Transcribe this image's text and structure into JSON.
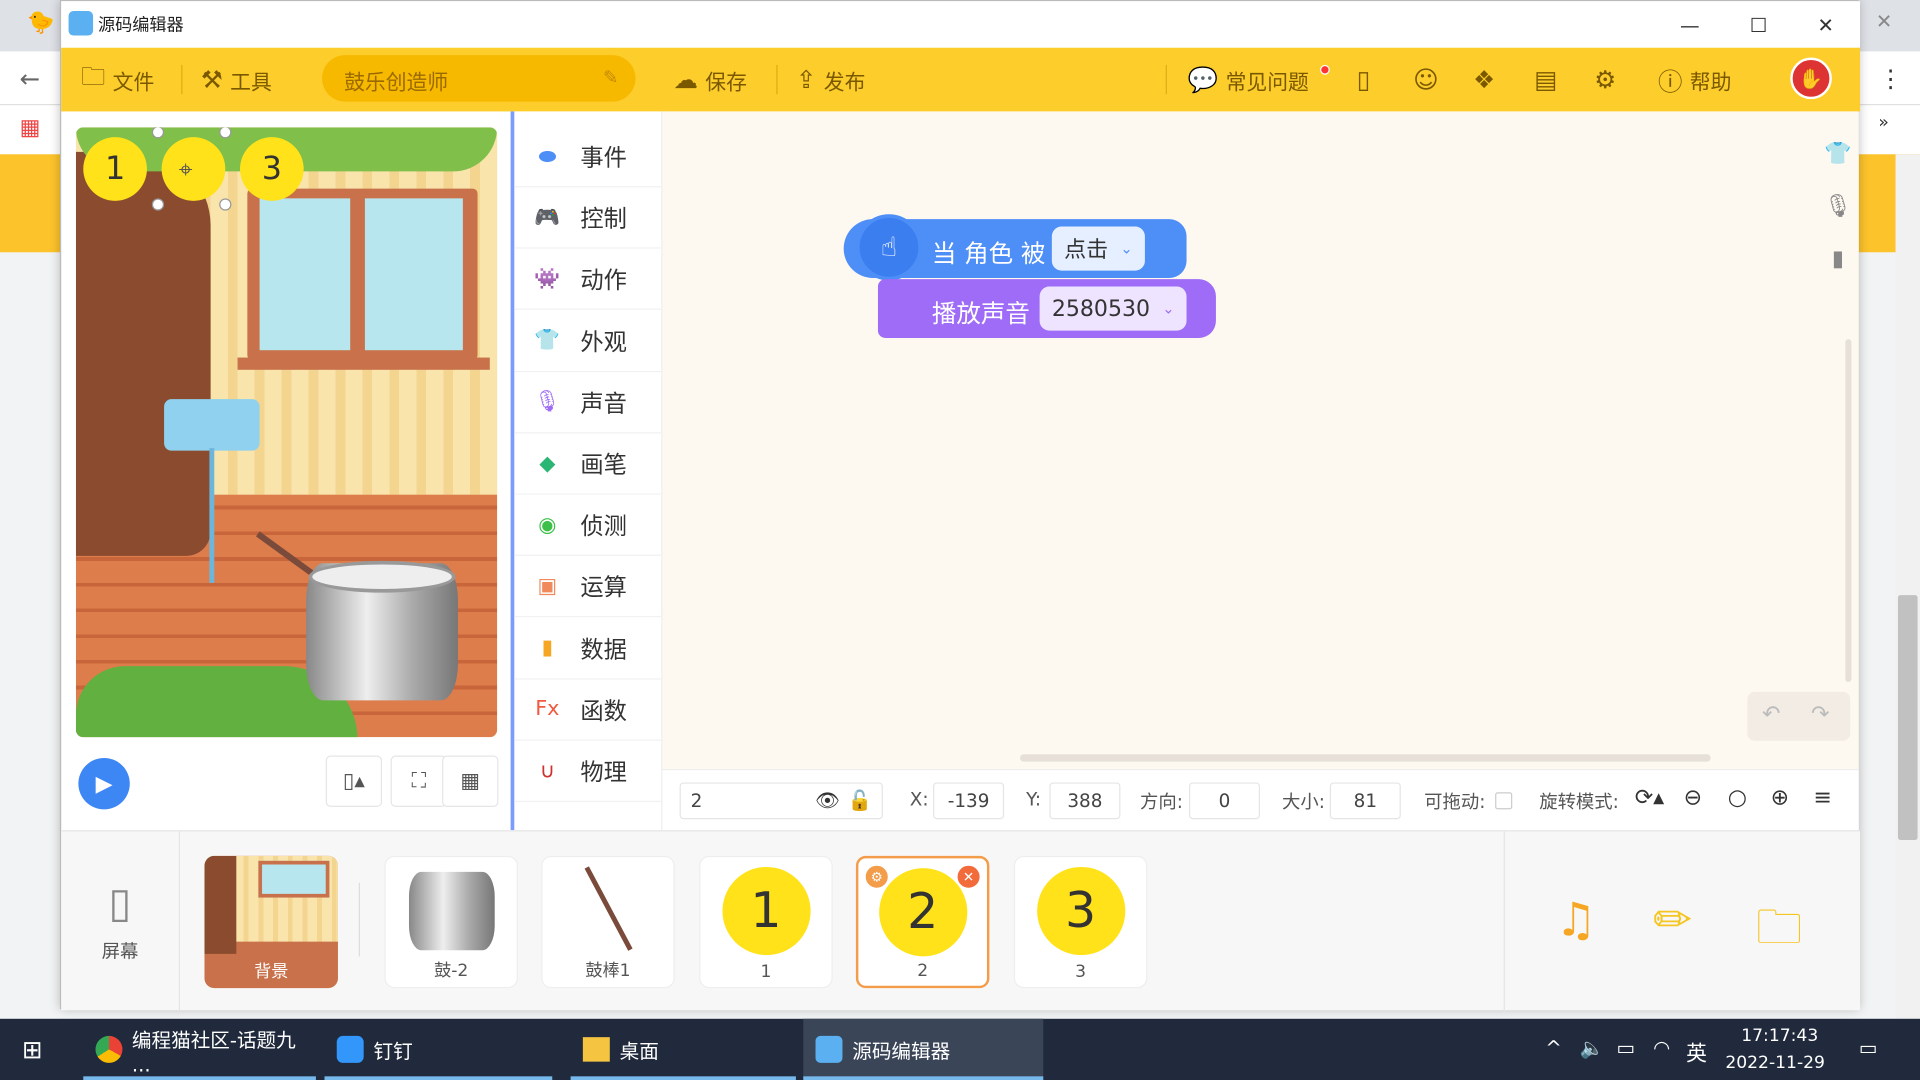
{
  "window": {
    "title": "源码编辑器",
    "minimize": "—",
    "maximize": "☐",
    "close": "✕"
  },
  "toolbar": {
    "file": "文件",
    "tools": "工具",
    "project_name": "鼓乐创造师",
    "save": "保存",
    "publish": "发布",
    "faq": "常见问题",
    "help": "帮助"
  },
  "stage": {
    "bubbles": [
      "1",
      "3"
    ]
  },
  "categories": [
    {
      "label": "事件",
      "color": "#4d8ef7",
      "icon": "toggle-icon"
    },
    {
      "label": "控制",
      "color": "#2fa6d8",
      "icon": "gamepad-icon"
    },
    {
      "label": "动作",
      "color": "#e8475a",
      "icon": "ghost-icon"
    },
    {
      "label": "外观",
      "color": "#e056c9",
      "icon": "shirt-icon"
    },
    {
      "label": "声音",
      "color": "#9f6cf7",
      "icon": "mic-icon"
    },
    {
      "label": "画笔",
      "color": "#2bb673",
      "icon": "pen-icon"
    },
    {
      "label": "侦测",
      "color": "#3cc04a",
      "icon": "radar-icon"
    },
    {
      "label": "运算",
      "color": "#f08a5d",
      "icon": "calc-icon"
    },
    {
      "label": "数据",
      "color": "#f5a623",
      "icon": "bars-icon"
    },
    {
      "label": "函数",
      "color": "#f05a3e",
      "icon": "fx-icon"
    },
    {
      "label": "物理",
      "color": "#d0312d",
      "icon": "magnet-icon"
    }
  ],
  "blocks": {
    "when": {
      "prefix": "当 角色 被",
      "dropdown": "点击"
    },
    "play": {
      "label": "播放声音",
      "dropdown": "2580530"
    }
  },
  "props": {
    "name": "2",
    "x_label": "X:",
    "x": "-139",
    "y_label": "Y:",
    "y": "388",
    "dir_label": "方向:",
    "dir": "0",
    "size_label": "大小:",
    "size": "81",
    "drag_label": "可拖动:",
    "rotate_label": "旋转模式:"
  },
  "sprites": {
    "screen_label": "屏幕",
    "items": [
      {
        "label": "背景"
      },
      {
        "label": "鼓-2"
      },
      {
        "label": "鼓棒1"
      },
      {
        "label": "1",
        "num": "1"
      },
      {
        "label": "2",
        "num": "2"
      },
      {
        "label": "3",
        "num": "3"
      }
    ]
  },
  "taskbar": {
    "chrome": "编程猫社区-话题九 ...",
    "dingtalk": "钉钉",
    "desktop": "桌面",
    "editor": "源码编辑器",
    "ime": "英",
    "time": "17:17:43",
    "date": "2022-11-29"
  },
  "colors": {
    "toolbar": "#fdcd2b",
    "event_block": "#4d8ef7",
    "sound_block": "#9f6cf7",
    "selected_border": "#f39c4a"
  }
}
